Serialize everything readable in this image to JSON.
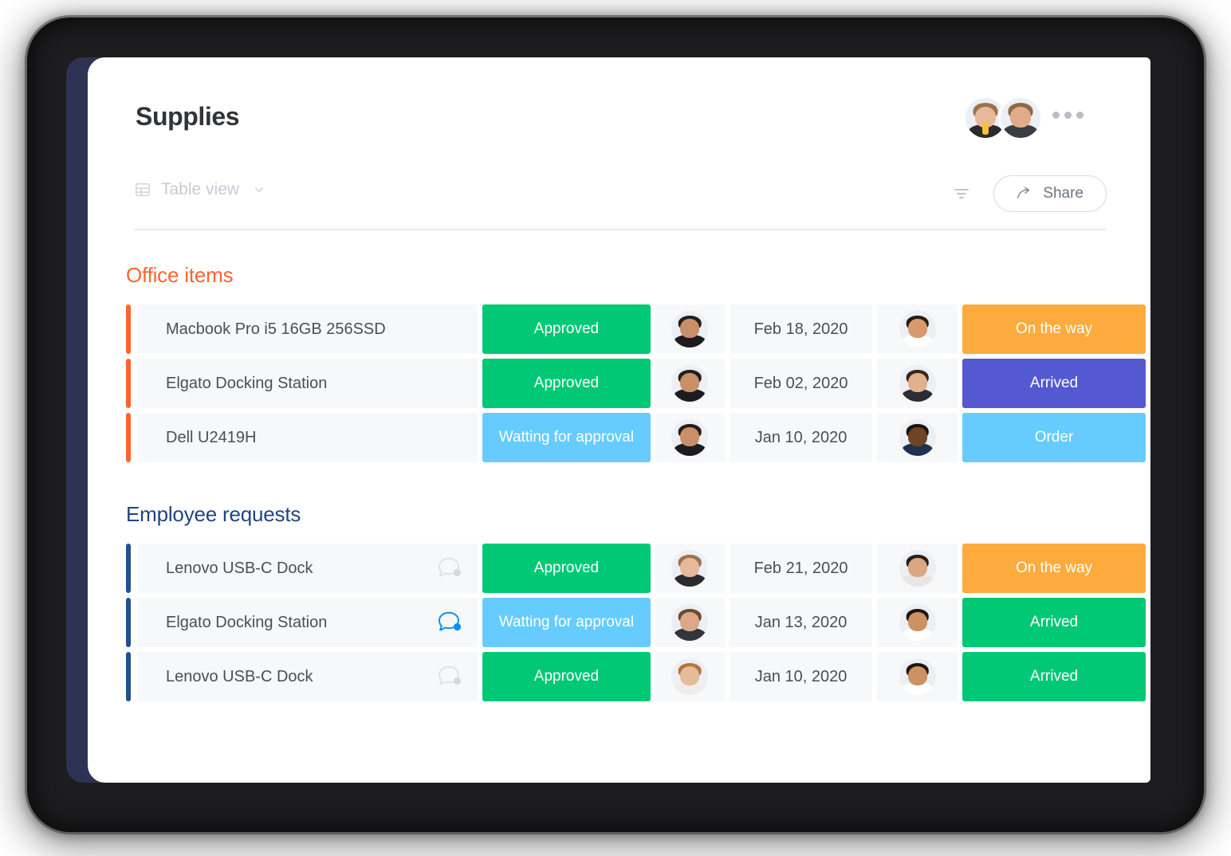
{
  "header": {
    "title": "Supplies",
    "members": [
      {
        "name": "member-avatar-1",
        "skin": "#e7b89a",
        "hair": "#9a7350",
        "shirt": "#2b2b2f",
        "accent": "#f5c138"
      },
      {
        "name": "member-avatar-2",
        "skin": "#e2ac8a",
        "hair": "#8d6a4a",
        "shirt": "#3a3d44",
        "accent": ""
      }
    ],
    "more_label": "more-options"
  },
  "toolbar": {
    "view_label": "Table view",
    "view_icon": "table-icon",
    "chevron_icon": "chevron-down-icon",
    "filter_icon": "filter-icon",
    "share_label": "Share",
    "share_icon": "share-arrow-icon"
  },
  "colors": {
    "green": "#00c875",
    "light_blue": "#66ccff",
    "orange": "#fdab3d",
    "purple": "#5559d1",
    "accent_orange": "#fb５275",
    "group_orange": "#ff642e",
    "group_blue": "#21457f",
    "row_bg": "#f7f8fa",
    "navy_spine": "#2e3356"
  },
  "groups": [
    {
      "title": "Office items",
      "title_color": "#ff642e",
      "accent_color": "#ff642e",
      "rows": [
        {
          "name": "Macbook Pro i5 16GB 256SSD",
          "chat": null,
          "status": "Approved",
          "status_color": "#00c875",
          "owner_avatar": {
            "skin": "#c98f68",
            "hair": "#221f1c",
            "shirt": "#1c1c20"
          },
          "date": "Feb 18, 2020",
          "second_avatar": {
            "skin": "#d89a6c",
            "hair": "#241d18",
            "shirt": "#ffffff"
          },
          "shipping": "On the way",
          "shipping_color": "#fdab3d"
        },
        {
          "name": "Elgato Docking Station",
          "chat": null,
          "status": "Approved",
          "status_color": "#00c875",
          "owner_avatar": {
            "skin": "#c98f68",
            "hair": "#221f1c",
            "shirt": "#1c1c20"
          },
          "date": "Feb 02, 2020",
          "second_avatar": {
            "skin": "#e0b18f",
            "hair": "#3a2519",
            "shirt": "#2d2b33"
          },
          "shipping": "Arrived",
          "shipping_color": "#5559d1"
        },
        {
          "name": "Dell U2419H",
          "chat": null,
          "status": "Watting for approval",
          "status_color": "#66ccff",
          "owner_avatar": {
            "skin": "#c98f68",
            "hair": "#221f1c",
            "shirt": "#1c1c20"
          },
          "date": "Jan 10, 2020",
          "second_avatar": {
            "skin": "#6d4526",
            "hair": "#181310",
            "shirt": "#1f3150"
          },
          "shipping": "Order",
          "shipping_color": "#66ccff"
        }
      ]
    },
    {
      "title": "Employee requests",
      "title_color": "#21457f",
      "accent_color": "#225091",
      "rows": [
        {
          "name": "Lenovo USB-C Dock",
          "chat": "chat-bubble-icon",
          "chat_active": false,
          "status": "Approved",
          "status_color": "#00c875",
          "owner_avatar": {
            "skin": "#e7b89a",
            "hair": "#9a7350",
            "shirt": "#2b2b2f"
          },
          "date": "Feb 21, 2020",
          "second_avatar": {
            "skin": "#d8a882",
            "hair": "#2c1d15",
            "shirt": "#e8e5e2"
          },
          "shipping": "On the way",
          "shipping_color": "#fdab3d"
        },
        {
          "name": "Elgato Docking Station",
          "chat": "chat-bubble-icon",
          "chat_active": true,
          "status": "Watting for approval",
          "status_color": "#66ccff",
          "owner_avatar": {
            "skin": "#dca887",
            "hair": "#6c4a30",
            "shirt": "#33353c"
          },
          "date": "Jan 13, 2020",
          "second_avatar": {
            "skin": "#cd9263",
            "hair": "#1d1712",
            "shirt": "#ffffff"
          },
          "shipping": "Arrived",
          "shipping_color": "#00c875"
        },
        {
          "name": "Lenovo USB-C Dock",
          "chat": "chat-bubble-icon",
          "chat_active": false,
          "status": "Approved",
          "status_color": "#00c875",
          "owner_avatar": {
            "skin": "#e6bb98",
            "hair": "#b5743a",
            "shirt": "#f0ecea"
          },
          "date": "Jan 10, 2020",
          "second_avatar": {
            "skin": "#cd9263",
            "hair": "#1d1712",
            "shirt": "#ffffff"
          },
          "shipping": "Arrived",
          "shipping_color": "#00c875"
        }
      ]
    }
  ]
}
